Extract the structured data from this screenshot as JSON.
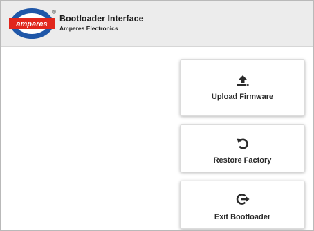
{
  "header": {
    "logo_text": "amperes",
    "logo_mark": "®",
    "title": "Bootloader Interface",
    "subtitle": "Amperes Electronics"
  },
  "actions": [
    {
      "label": "Upload Firmware",
      "icon": "upload-icon"
    },
    {
      "label": "Restore Factory",
      "icon": "restore-icon"
    },
    {
      "label": "Exit Bootloader",
      "icon": "exit-icon"
    }
  ],
  "colors": {
    "header_bg": "#ececec",
    "logo_blue": "#1f57a8",
    "logo_red": "#e1261c",
    "icon": "#2a2a2a"
  }
}
